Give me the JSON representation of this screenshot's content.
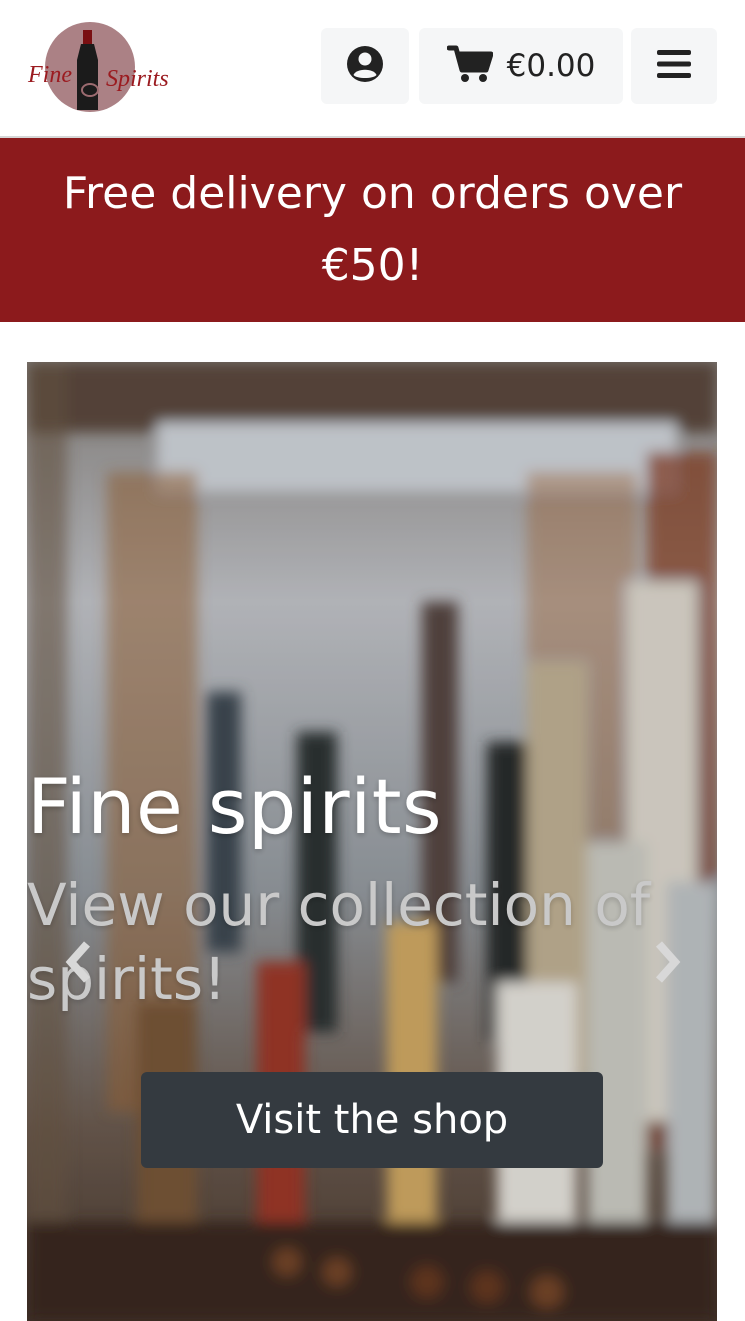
{
  "header": {
    "logo_text_left": "Fine",
    "logo_text_right": "Spirits",
    "cart_total": "€0.00"
  },
  "banner": {
    "text": "Free delivery on orders over €50!"
  },
  "hero": {
    "title": "Fine spirits",
    "subtitle": "View our collection of spirits!",
    "cta_label": "Visit the shop"
  },
  "colors": {
    "banner": "#8c1a1c",
    "cta": "#343a40",
    "header_button": "#f5f6f7"
  },
  "icons": [
    "user-circle-icon",
    "shopping-cart-icon",
    "hamburger-menu-icon",
    "chevron-left-icon",
    "chevron-right-icon"
  ]
}
